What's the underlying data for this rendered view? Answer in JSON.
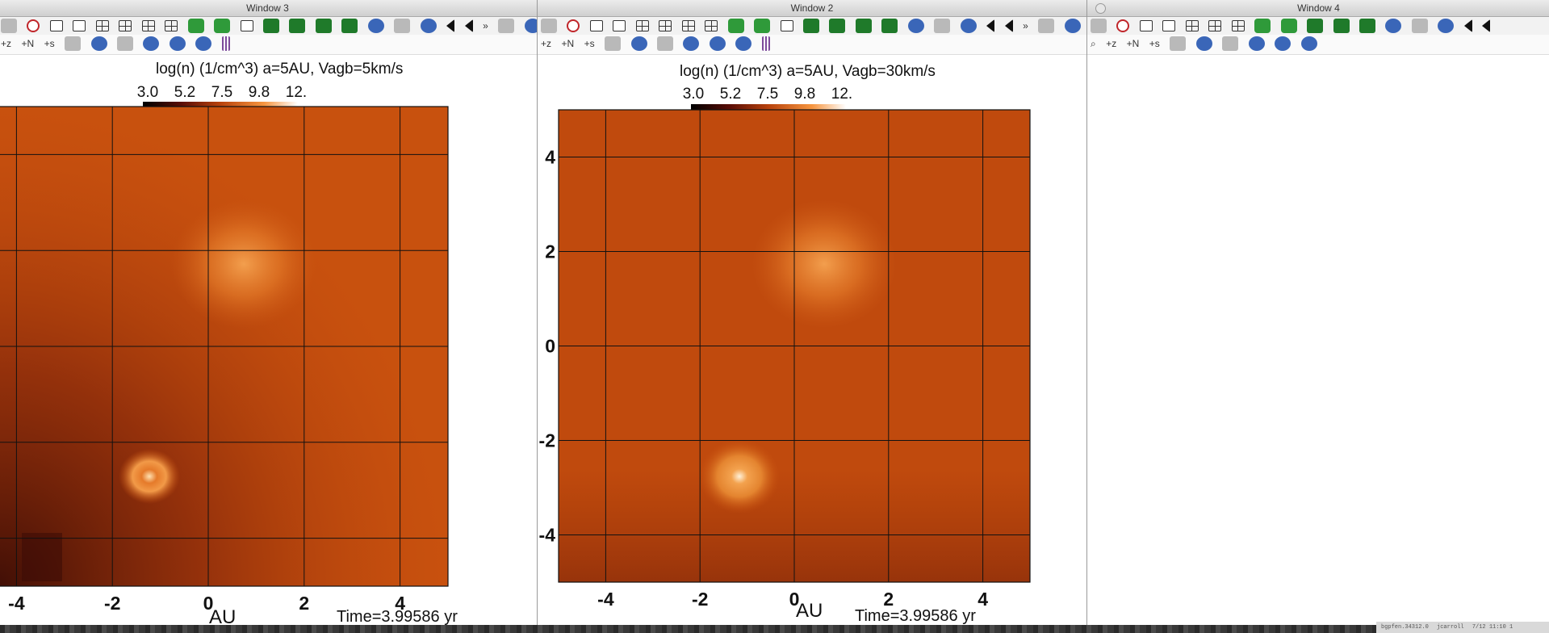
{
  "windows": [
    {
      "id": "w3",
      "title": "Window 3",
      "plot": {
        "title": "log(n) (1/cm^3)   a=5AU, Vagb=5km/s",
        "colorbar_ticks": [
          "3.0",
          "5.2",
          "7.5",
          "9.8",
          "12."
        ],
        "xlabel": "AU",
        "time": "Time=3.99586 yr",
        "x_ticks": [
          "-4",
          "-2",
          "0",
          "2",
          "4"
        ],
        "y_ticks": []
      }
    },
    {
      "id": "w2",
      "title": "Window 2",
      "plot": {
        "title": "log(n) (1/cm^3)   a=5AU, Vagb=30km/s",
        "colorbar_ticks": [
          "3.0",
          "5.2",
          "7.5",
          "9.8",
          "12."
        ],
        "xlabel": "AU",
        "time": "Time=3.99586 yr",
        "x_ticks": [
          "-4",
          "-2",
          "0",
          "2",
          "4"
        ],
        "y_ticks": [
          "4",
          "2",
          "0",
          "-2",
          "-4"
        ]
      }
    },
    {
      "id": "w4",
      "title": "Window 4"
    }
  ],
  "status": {
    "left": "bgpfen.34312.0",
    "user": "jcarroll",
    "clock": "7/12 11:10 1"
  },
  "colors": {
    "field": "#c9520e",
    "bright": "#f5a14a",
    "dark": "#3a0b05"
  }
}
